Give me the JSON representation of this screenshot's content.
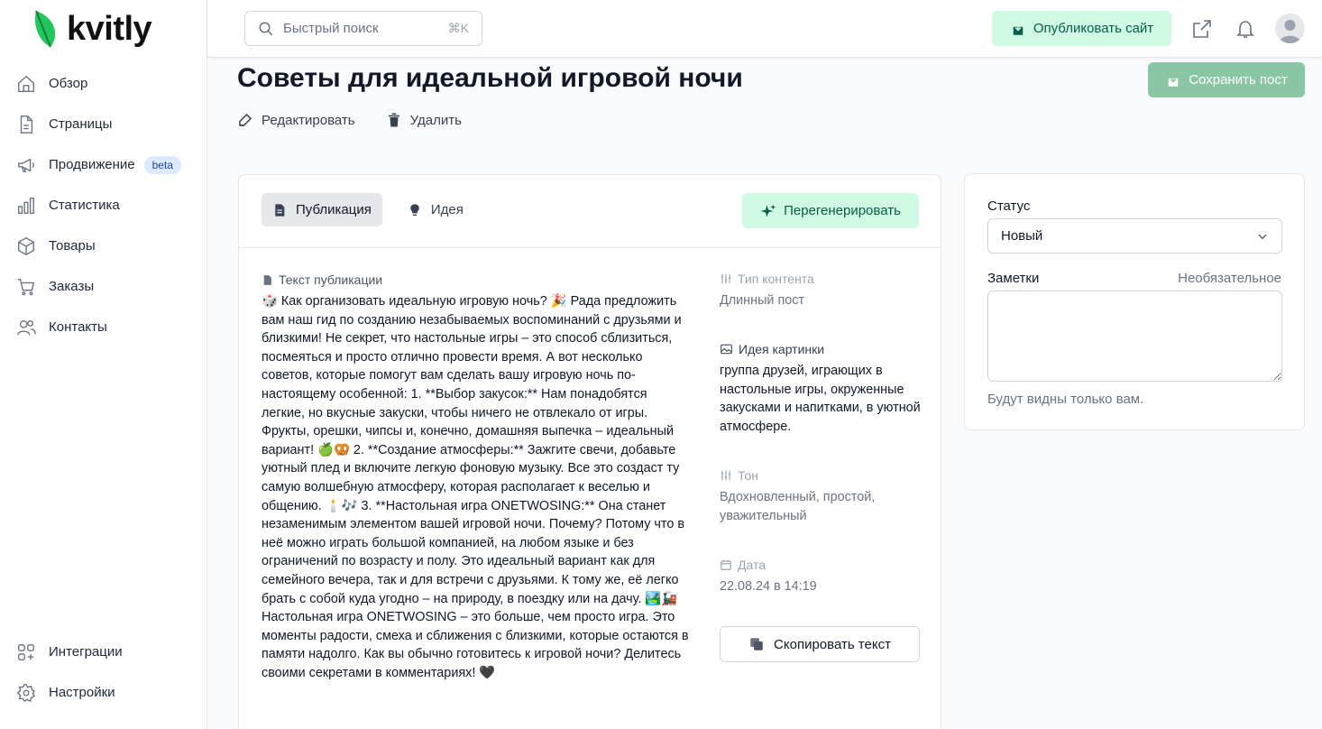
{
  "app": {
    "logo": "kvitly",
    "brand_color": "#22c55e"
  },
  "sidebar": {
    "items": [
      {
        "label": "Обзор",
        "icon": "home-icon"
      },
      {
        "label": "Страницы",
        "icon": "document-icon"
      },
      {
        "label": "Продвижение",
        "icon": "megaphone-icon",
        "badge": "beta"
      },
      {
        "label": "Статистика",
        "icon": "bar-chart-icon"
      },
      {
        "label": "Товары",
        "icon": "box-icon"
      },
      {
        "label": "Заказы",
        "icon": "cart-icon"
      },
      {
        "label": "Контакты",
        "icon": "users-icon"
      }
    ],
    "bottom_items": [
      {
        "label": "Интеграции",
        "icon": "grid-plus-icon"
      },
      {
        "label": "Настройки",
        "icon": "gear-icon"
      }
    ]
  },
  "topbar": {
    "search_placeholder": "Быстрый поиск",
    "search_shortcut": "⌘K",
    "publish_label": "Опубликовать сайт"
  },
  "post": {
    "title": "Советы для идеальной игровой ночи",
    "save_label": "Сохранить пост",
    "edit_label": "Редактировать",
    "delete_label": "Удалить"
  },
  "tabs": [
    {
      "label": "Публикация",
      "active": true
    },
    {
      "label": "Идея",
      "active": false
    }
  ],
  "regenerate_label": "Перегенерировать",
  "publication": {
    "label": "Текст публикации",
    "text": "🎲 Как организовать идеальную игровую ночь? 🎉 Рада предложить вам наш гид по созданию незабываемых воспоминаний с друзьями и близкими! Не секрет, что настольные игры – это способ сблизиться, посмеяться и просто отлично провести время. А вот несколько советов, которые помогут вам сделать вашу игровую ночь по-настоящему особенной: 1. **Выбор закусок:** Нам понадобятся легкие, но вкусные закуски, чтобы ничего не отвлекало от игры. Фрукты, орешки, чипсы и, конечно, домашняя выпечка – идеальный вариант! 🍏🥨 2. **Создание атмосферы:** Зажгите свечи, добавьте уютный плед и включите легкую фоновую музыку. Все это создаст ту самую волшебную атмосферу, которая располагает к веселью и общению. 🕯️🎶 3. **Настольная игра ONETWOSING:** Она станет незаменимым элементом вашей игровой ночи. Почему? Потому что в неё можно играть большой компанией, на любом языке и без ограничений по возрасту и полу. Это идеальный вариант как для семейного вечера, так и для встречи с друзьями. К тому же, её легко брать с собой куда угодно – на природу, в поездку или на дачу. 🏞️🚂 Настольная игра ONETWOSING – это больше, чем просто игра. Это моменты радости, смеха и сближения с близкими, которые остаются в памяти надолго. Как вы обычно готовитесь к игровой ночи? Делитесь своими секретами в комментариях! 🖤"
  },
  "meta": {
    "content_type_label": "Тип контента",
    "content_type_value": "Длинный пост",
    "image_idea_label": "Идея картинки",
    "image_idea_value": "группа друзей, играющих в настольные игры, окруженные закусками и напитками, в уютной атмосфере.",
    "tone_label": "Тон",
    "tone_value": "Вдохновленный, простой, уважительный",
    "date_label": "Дата",
    "date_value": "22.08.24 в 14:19",
    "copy_label": "Скопировать текст"
  },
  "side": {
    "status_label": "Статус",
    "status_value": "Новый",
    "notes_label": "Заметки",
    "notes_optional": "Необязательное",
    "notes_value": "",
    "notes_hint": "Будут видны только вам."
  }
}
